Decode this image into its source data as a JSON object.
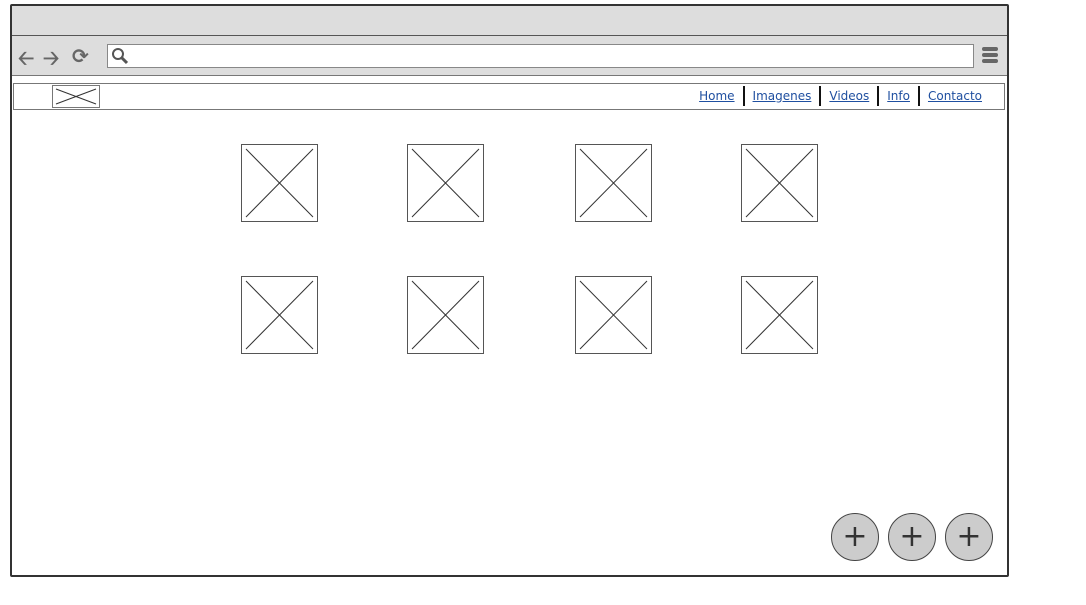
{
  "browser": {
    "back_icon": "arrow-left-icon",
    "forward_icon": "arrow-right-icon",
    "reload_icon": "reload-icon",
    "search_icon": "search-icon",
    "menu_icon": "hamburger-icon",
    "url_value": ""
  },
  "nav": {
    "links": [
      "Home",
      "Imagenes",
      "Videos",
      "Info",
      "Contacto"
    ],
    "link_color": "#1f4fa0"
  },
  "gallery": {
    "image_count": 8
  },
  "actions": {
    "buttons": [
      "+",
      "+",
      "+"
    ]
  }
}
